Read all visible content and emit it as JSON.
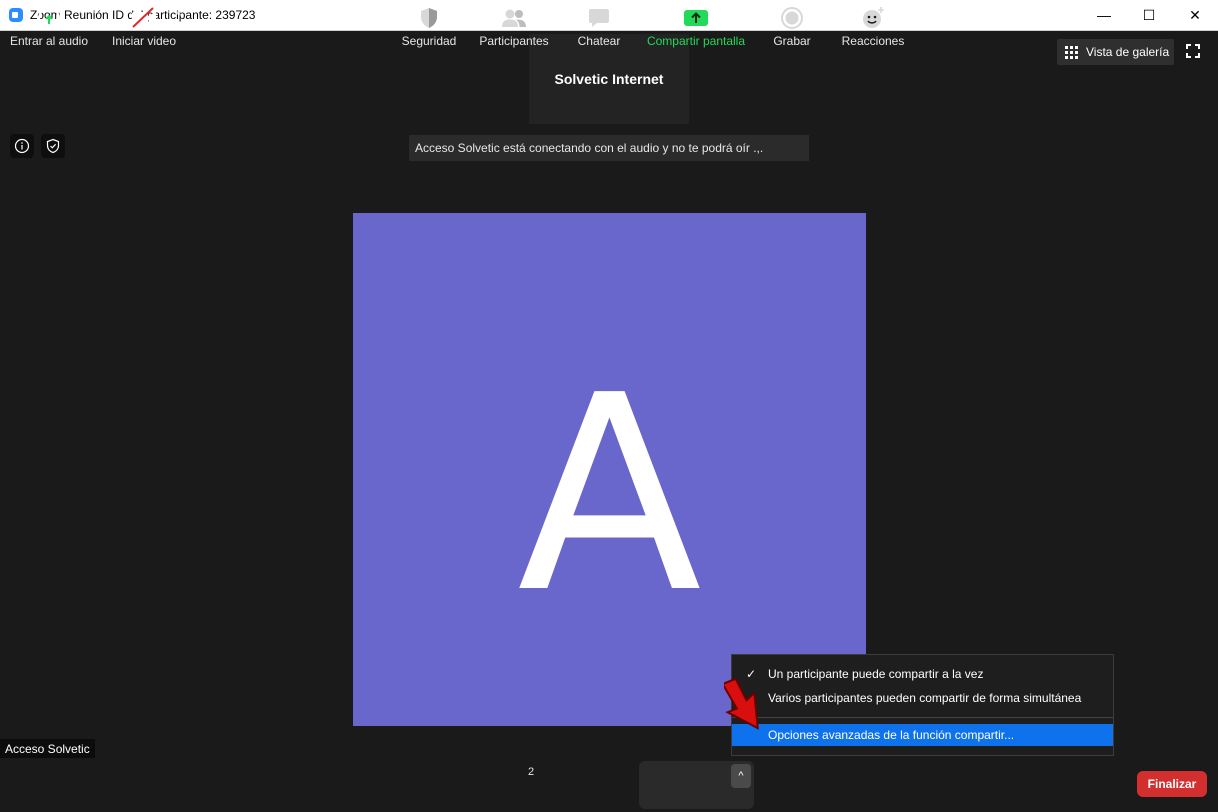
{
  "window": {
    "title": "Zoom Reunión ID del participante: 239723",
    "minimize_glyph": "—",
    "maximize_glyph": "☐",
    "close_glyph": "✕"
  },
  "meeting": {
    "speaker_name": "Solvetic Internet",
    "gallery_view_label": "Vista de galería",
    "notice": "Acceso Solvetic está conectando con el audio y no te podrá oír  .,.",
    "avatar_letter": "A",
    "avatar_color": "#6966cc",
    "participant_label": "Acceso Solvetic"
  },
  "share_menu": {
    "items": [
      {
        "label": "Un participante puede compartir a la vez",
        "checked": true
      },
      {
        "label": "Varios participantes pueden compartir de forma simultánea",
        "checked": false
      }
    ],
    "advanced_label": "Opciones avanzadas de la función compartir...",
    "check_glyph": "✓",
    "highlight_color": "#0e72ed"
  },
  "toolbar": {
    "audio_label": "Entrar al audio",
    "video_label": "Iniciar video",
    "security_label": "Seguridad",
    "participants_label": "Participantes",
    "participants_count": "2",
    "chat_label": "Chatear",
    "share_label": "Compartir pantalla",
    "record_label": "Grabar",
    "reactions_label": "Reacciones",
    "end_label": "Finalizar",
    "caret_glyph": "^",
    "share_color": "#23d959",
    "end_color": "#d32f2f"
  }
}
